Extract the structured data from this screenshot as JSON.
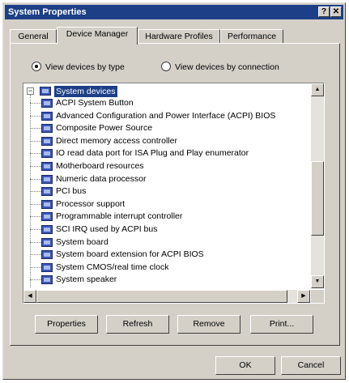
{
  "window": {
    "title": "System Properties",
    "help_label": "?",
    "close_label": "✕",
    "title_bar_color": "#1d3f87",
    "face_color": "#d4d0c8"
  },
  "tabs": [
    {
      "label": "General",
      "active": false
    },
    {
      "label": "Device Manager",
      "active": true
    },
    {
      "label": "Hardware Profiles",
      "active": false
    },
    {
      "label": "Performance",
      "active": false
    }
  ],
  "view_options": {
    "by_type": {
      "label": "View devices by type",
      "selected": true
    },
    "by_connection": {
      "label": "View devices by connection",
      "selected": false
    }
  },
  "device_tree": {
    "root": {
      "label": "System devices",
      "expander": "−",
      "selected": true,
      "icon": "computer-icon"
    },
    "items": [
      "ACPI System Button",
      "Advanced Configuration and Power Interface (ACPI) BIOS",
      "Composite Power Source",
      "Direct memory access controller",
      "IO read data port for ISA Plug and Play enumerator",
      "Motherboard resources",
      "Numeric data processor",
      "PCI bus",
      "Processor support",
      "Programmable interrupt controller",
      "SCI IRQ used by ACPI bus",
      "System board",
      "System board extension for ACPI BIOS",
      "System CMOS/real time clock",
      "System speaker"
    ],
    "item_icon": "device-icon"
  },
  "action_buttons": {
    "properties": "Properties",
    "refresh": "Refresh",
    "remove": "Remove",
    "print": "Print..."
  },
  "dialog_buttons": {
    "ok": "OK",
    "cancel": "Cancel"
  }
}
